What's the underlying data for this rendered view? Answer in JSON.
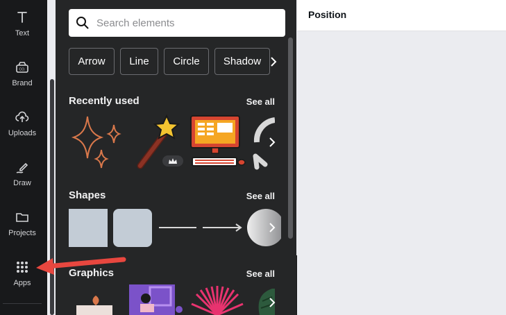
{
  "rail": {
    "items": [
      {
        "label": "Text",
        "icon": "text-icon"
      },
      {
        "label": "Brand",
        "icon": "brand-icon"
      },
      {
        "label": "Uploads",
        "icon": "cloud-upload-icon"
      },
      {
        "label": "Draw",
        "icon": "draw-icon"
      },
      {
        "label": "Projects",
        "icon": "folder-icon"
      },
      {
        "label": "Apps",
        "icon": "apps-grid-icon"
      }
    ]
  },
  "search": {
    "placeholder": "Search elements"
  },
  "chips": [
    "Arrow",
    "Line",
    "Circle",
    "Shadow"
  ],
  "sections": {
    "recently_used": {
      "title": "Recently used",
      "see_all": "See all"
    },
    "shapes": {
      "title": "Shapes",
      "see_all": "See all"
    },
    "graphics": {
      "title": "Graphics",
      "see_all": "See all"
    }
  },
  "right_panel": {
    "title": "Position"
  },
  "colors": {
    "rail_bg": "#18191b",
    "panel_bg": "#252627",
    "annotation_arrow": "#e8473f",
    "shape_fill": "#c3ccd6"
  }
}
